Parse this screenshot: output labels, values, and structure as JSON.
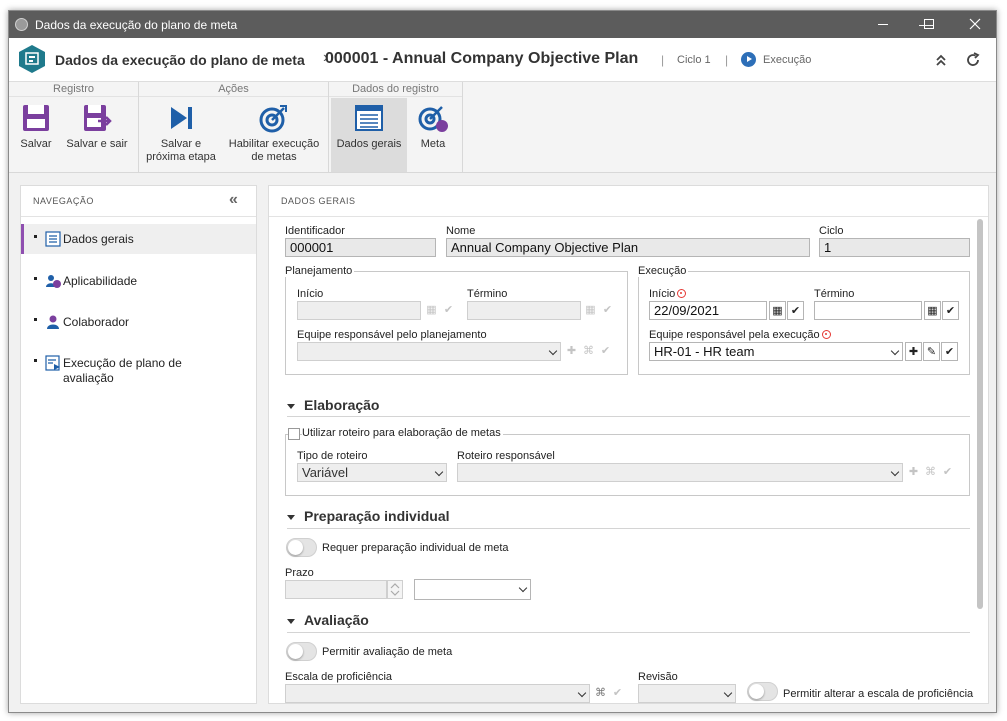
{
  "window": {
    "title": "Dados da execução do plano de meta"
  },
  "header": {
    "breadcrumb1": "Dados da execução do plano de meta",
    "separator": "›",
    "breadcrumb2": "000001 - Annual Company Objective Plan",
    "ciclo": "Ciclo 1",
    "execucao": "Execução",
    "accent": "#1f7a8c"
  },
  "ribbon": {
    "groups": [
      "Registro",
      "Ações",
      "Dados do registro"
    ],
    "buttons": {
      "salvar": "Salvar",
      "salvar_sair": "Salvar e sair",
      "salvar_proxima_1": "Salvar e",
      "salvar_proxima_2": "próxima etapa",
      "habilitar_1": "Habilitar execução",
      "habilitar_2": "de metas",
      "dados_gerais": "Dados gerais",
      "meta": "Meta"
    },
    "icon_color": "#7b3f9e"
  },
  "nav": {
    "title": "NAVEGAÇÃO",
    "items": [
      {
        "label": "Dados gerais",
        "icon": "list-icon"
      },
      {
        "label": "Aplicabilidade",
        "icon": "users-icon"
      },
      {
        "label": "Colaborador",
        "icon": "user-icon"
      },
      {
        "label_1": "Execução de plano de",
        "label_2": "avaliação",
        "icon": "execution-plan-icon"
      }
    ],
    "selected_color": "#8f4fb0"
  },
  "content": {
    "title": "DADOS GERAIS",
    "identificador": {
      "label": "Identificador",
      "value": "000001"
    },
    "nome": {
      "label": "Nome",
      "value": "Annual Company Objective Plan"
    },
    "ciclo": {
      "label": "Ciclo",
      "value": "1"
    },
    "planejamento": {
      "legend": "Planejamento",
      "inicio_label": "Início",
      "termino_label": "Término",
      "equipe_label": "Equipe responsável pelo planejamento"
    },
    "execucao": {
      "legend": "Execução",
      "inicio_label": "Início",
      "inicio_value": "22/09/2021",
      "termino_label": "Término",
      "equipe_label": "Equipe responsável pela execução",
      "equipe_value": "HR-01 - HR team"
    },
    "elaboracao": {
      "title": "Elaboração",
      "checkbox_label": "Utilizar roteiro para elaboração de metas",
      "tipo_label": "Tipo de roteiro",
      "tipo_value": "Variável",
      "roteiro_label": "Roteiro responsável"
    },
    "preparacao": {
      "title": "Preparação individual",
      "toggle_label": "Requer preparação individual de meta",
      "prazo_label": "Prazo"
    },
    "avaliacao": {
      "title": "Avaliação",
      "toggle_label": "Permitir avaliação de meta",
      "escala_label": "Escala de proficiência",
      "revisao_label": "Revisão",
      "alterar_label": "Permitir alterar a escala de proficiência"
    },
    "required_color": "#e53935"
  }
}
